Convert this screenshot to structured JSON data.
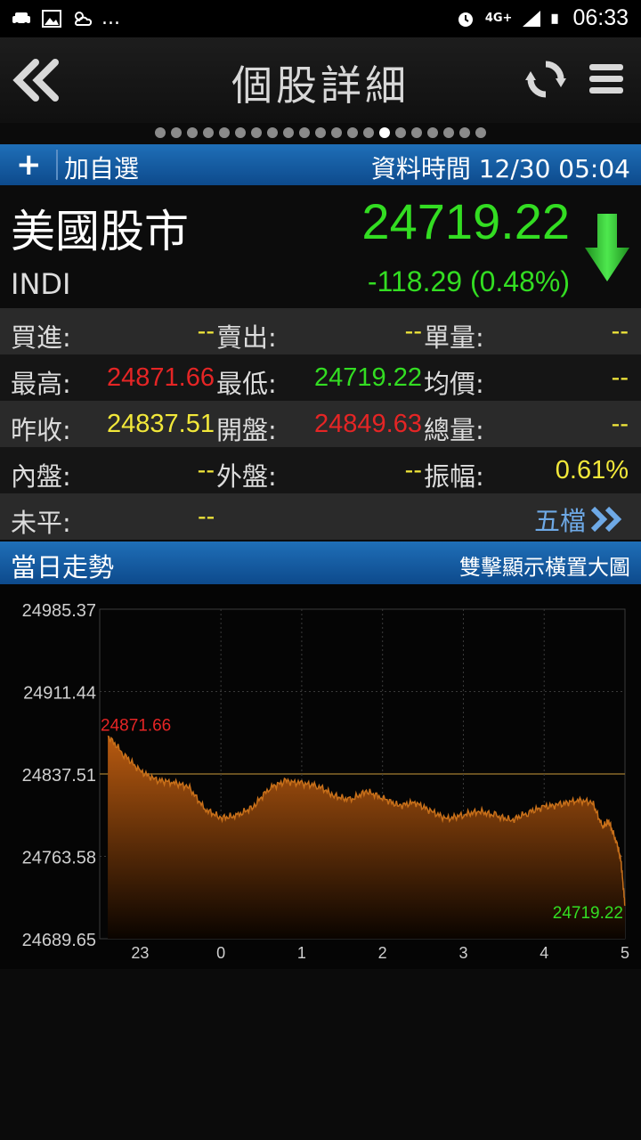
{
  "status_bar": {
    "left_icons": [
      "car-icon",
      "image-icon",
      "weather-icon"
    ],
    "overflow": "...",
    "network": "4G+",
    "time": "06:33"
  },
  "app_bar": {
    "title": "個股詳細"
  },
  "pager": {
    "count": 21,
    "active_index": 14
  },
  "toolbar": {
    "add_icon": "+",
    "add_label": "加自選",
    "data_time": "資料時間 12/30 05:04"
  },
  "quote": {
    "name": "美國股市",
    "code": "INDI",
    "price": "24719.22",
    "change": "-118.29 (0.48%)",
    "direction": "down",
    "color_down": "#33dd22",
    "color_up": "#e52525"
  },
  "table": {
    "rows": [
      [
        {
          "label": "買進:",
          "value": "--",
          "color": "yellow"
        },
        {
          "label": "賣出:",
          "value": "--",
          "color": "yellow"
        },
        {
          "label": "單量:",
          "value": "--",
          "color": "yellow"
        }
      ],
      [
        {
          "label": "最高:",
          "value": "24871.66",
          "color": "red"
        },
        {
          "label": "最低:",
          "value": "24719.22",
          "color": "green"
        },
        {
          "label": "均價:",
          "value": "--",
          "color": "yellow"
        }
      ],
      [
        {
          "label": "昨收:",
          "value": "24837.51",
          "color": "yellow"
        },
        {
          "label": "開盤:",
          "value": "24849.63",
          "color": "red"
        },
        {
          "label": "總量:",
          "value": "--",
          "color": "yellow"
        }
      ],
      [
        {
          "label": "內盤:",
          "value": "--",
          "color": "yellow"
        },
        {
          "label": "外盤:",
          "value": "--",
          "color": "yellow"
        },
        {
          "label": "振幅:",
          "value": "0.61%",
          "color": "yellow"
        }
      ]
    ],
    "last_row": {
      "label": "未平:",
      "value": "--",
      "link": "五檔"
    }
  },
  "trend_bar": {
    "title": "當日走勢",
    "hint": "雙擊顯示橫置大圖"
  },
  "chart_data": {
    "type": "area",
    "y_ticks": [
      "24985.37",
      "24911.44",
      "24837.51",
      "24763.58",
      "24689.65"
    ],
    "ylim": [
      24689.65,
      24985.37
    ],
    "reference_line": 24837.51,
    "x_ticks": [
      "23",
      "0",
      "1",
      "2",
      "3",
      "4",
      "5"
    ],
    "high_label": "24871.66",
    "low_label": "24719.22",
    "x": [
      22.6,
      22.8,
      23.0,
      23.2,
      23.4,
      23.6,
      23.8,
      24.0,
      24.2,
      24.4,
      24.6,
      24.8,
      25.0,
      25.2,
      25.4,
      25.6,
      25.8,
      26.0,
      26.2,
      26.4,
      26.6,
      26.8,
      27.0,
      27.2,
      27.4,
      27.6,
      27.8,
      28.0,
      28.2,
      28.4,
      28.6,
      28.72,
      28.8,
      28.9,
      28.95,
      29.0
    ],
    "values": [
      24871.66,
      24855,
      24840,
      24832,
      24830,
      24826,
      24806,
      24798,
      24800,
      24808,
      24825,
      24831,
      24829,
      24827,
      24818,
      24814,
      24822,
      24816,
      24809,
      24812,
      24804,
      24797,
      24801,
      24804,
      24800,
      24796,
      24803,
      24808,
      24810,
      24814,
      24812,
      24790,
      24795,
      24775,
      24760,
      24719.22
    ],
    "colors": {
      "line": "#c8701a",
      "fill_top": "#b85a10",
      "fill_bottom": "#0a0400",
      "grid": "#3a3a3a",
      "ref": "#8a6a2a",
      "high": "#e52525",
      "low": "#33dd22"
    }
  }
}
